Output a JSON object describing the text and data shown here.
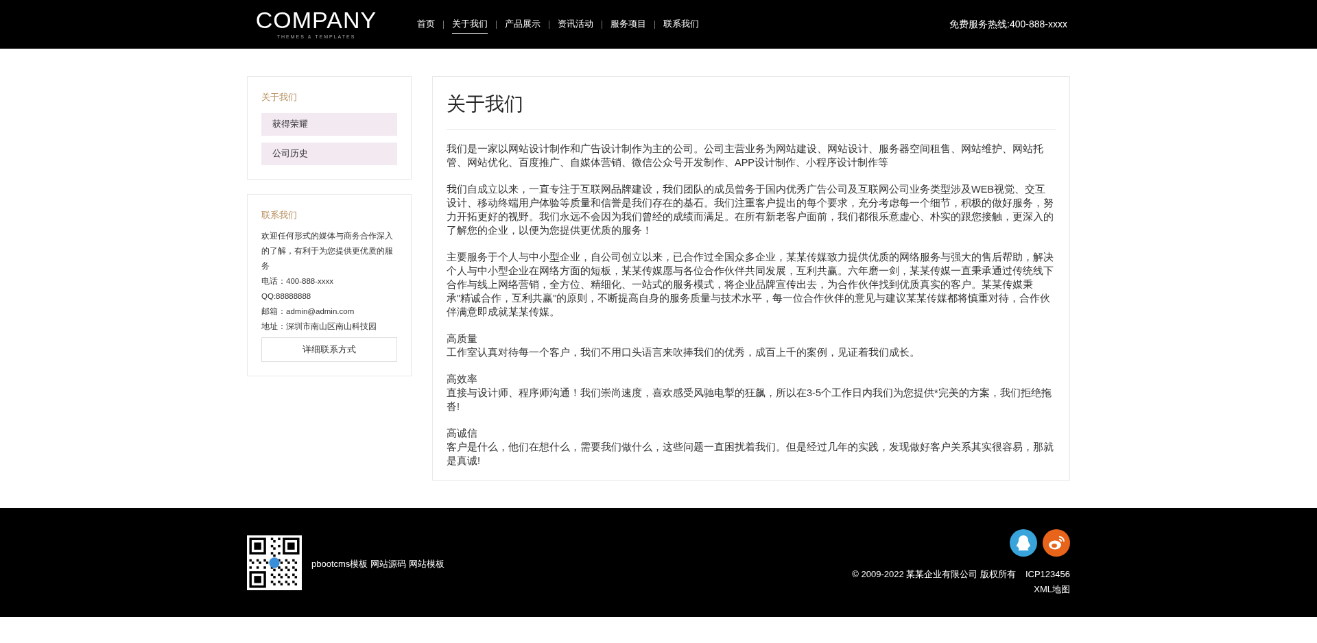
{
  "header": {
    "logo": "COMPANY",
    "logo_tagline": "THEMES & TEMPLATES",
    "nav": [
      {
        "label": "首页",
        "selected": false
      },
      {
        "label": "关于我们",
        "selected": true
      },
      {
        "label": "产品展示",
        "selected": false
      },
      {
        "label": "资讯活动",
        "selected": false
      },
      {
        "label": "服务项目",
        "selected": false
      },
      {
        "label": "联系我们",
        "selected": false
      }
    ],
    "hotline": "免费服务热线:400-888-xxxx"
  },
  "sidebar": {
    "about": {
      "title": "关于我们",
      "items": [
        "获得荣耀",
        "公司历史"
      ]
    },
    "contact": {
      "title": "联系我们",
      "intro": "欢迎任何形式的媒体与商务合作深入的了解，有利于为您提供更优质的服务",
      "lines": [
        "电话：400-888-xxxx",
        "QQ:88888888",
        "邮箱：admin@admin.com",
        "地址：深圳市南山区南山科技园"
      ],
      "button": "详细联系方式"
    }
  },
  "content": {
    "title": "关于我们",
    "blocks": [
      {
        "text": "我们是一家以网站设计制作和广告设计制作为主的公司。公司主营业务为网站建设、网站设计、服务器空间租售、网站维护、网站托管、网站优化、百度推广、自媒体营销、微信公众号开发制作、APP设计制作、小程序设计制作等"
      },
      {
        "text": "我们自成立以来，一直专注于互联网品牌建设，我们团队的成员曾务于国内优秀广告公司及互联网公司业务类型涉及WEB视觉、交互设计、移动终端用户体验等质量和信誉是我们存在的基石。我们注重客户提出的每个要求，充分考虑每一个细节，积极的做好服务，努力开拓更好的视野。我们永远不会因为我们曾经的成绩而满足。在所有新老客户面前，我们都很乐意虚心、朴实的跟您接触，更深入的了解您的企业，以便为您提供更优质的服务！"
      },
      {
        "text": "主要服务于个人与中小型企业，自公司创立以来，已合作过全国众多企业，某某传媒致力提供优质的网络服务与强大的售后帮助，解决个人与中小型企业在网络方面的短板，某某传媒愿与各位合作伙伴共同发展，互利共赢。六年磨一剑，某某传媒一直秉承通过传统线下合作与线上网络营销，全方位、精细化、一站式的服务模式，将企业品牌宣传出去，为合作伙伴找到优质真实的客户。某某传媒秉承\"精诚合作，互利共赢\"的原则，不断提高自身的服务质量与技术水平，每一位合作伙伴的意见与建议某某传媒都将慎重对待，合作伙伴满意即成就某某传媒。"
      },
      {
        "heading": "高质量",
        "text": "工作室认真对待每一个客户，我们不用口头语言来吹捧我们的优秀，成百上千的案例，见证着我们成长。"
      },
      {
        "heading": "高效率",
        "text": "直接与设计师、程序师沟通！我们崇尚速度，喜欢感受风驰电掣的狂飙，所以在3-5个工作日内我们为您提供*完美的方案，我们拒绝拖沓!"
      },
      {
        "heading": "高诚信",
        "text": "客户是什么，他们在想什么，需要我们做什么，这些问题一直困扰着我们。但是经过几年的实践，发现做好客户关系其实很容易，那就是真诚!"
      }
    ]
  },
  "footer": {
    "links": [
      "pbootcms模板",
      "网站源码",
      "网站模板"
    ],
    "copyright": "© 2009-2022 某某企业有限公司 版权所有",
    "icp": "ICP123456",
    "sitemap": "XML地图"
  }
}
